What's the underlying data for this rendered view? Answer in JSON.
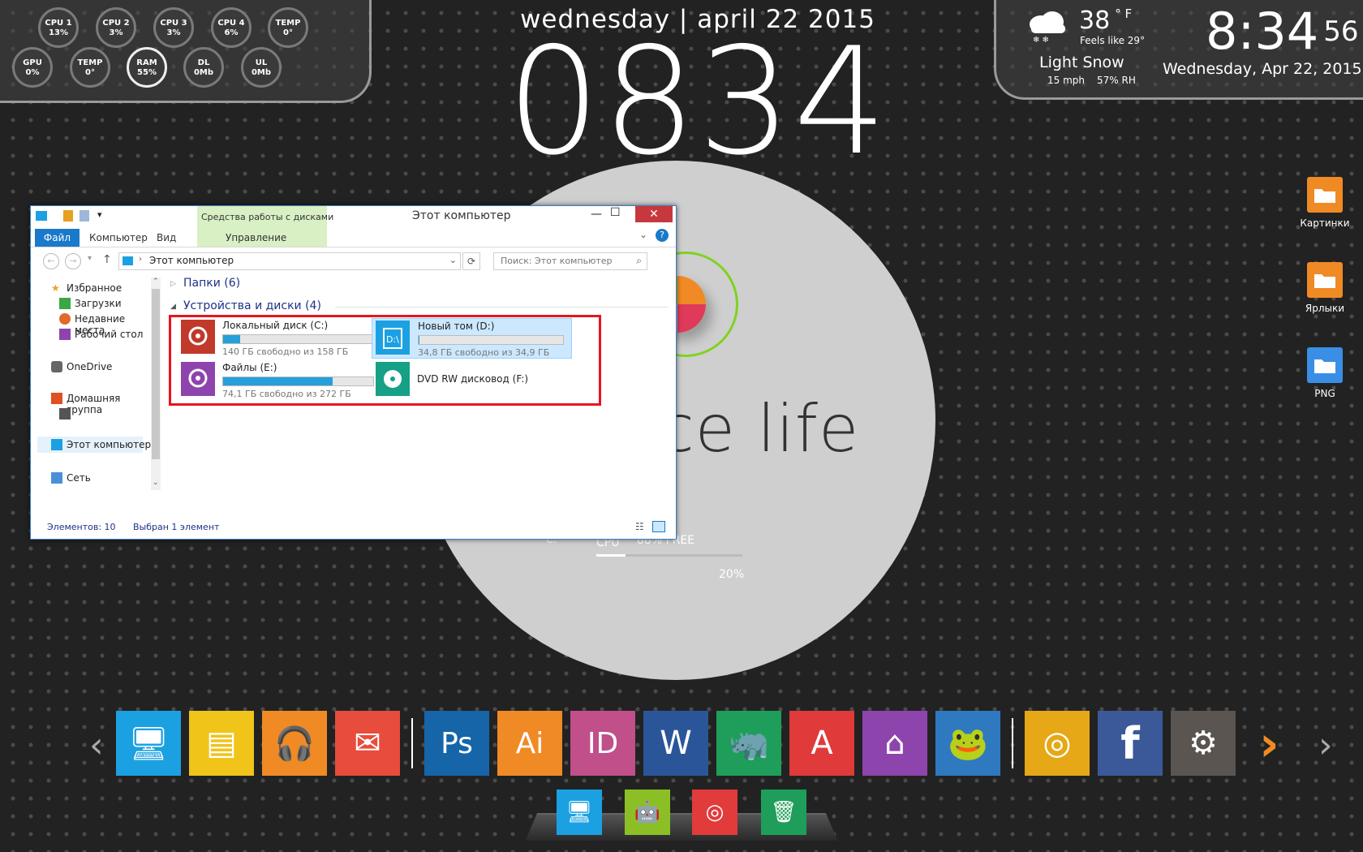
{
  "sysmon": {
    "row1": [
      {
        "label": "CPU 1",
        "value": "13%"
      },
      {
        "label": "CPU 2",
        "value": "3%"
      },
      {
        "label": "CPU 3",
        "value": "3%"
      },
      {
        "label": "CPU 4",
        "value": "6%"
      },
      {
        "label": "TEMP",
        "value": "0°"
      }
    ],
    "row2": [
      {
        "label": "GPU",
        "value": "0%"
      },
      {
        "label": "TEMP",
        "value": "0°"
      },
      {
        "label": "RAM",
        "value": "55%"
      },
      {
        "label": "DL",
        "value": "0Mb"
      },
      {
        "label": "UL",
        "value": "0Mb"
      }
    ]
  },
  "clock": {
    "date_line": "wednesday | april 22 2015",
    "big_time": "0834"
  },
  "weather": {
    "temp": "38",
    "unit": "° F",
    "feels": "Feels like 29°",
    "condition": "Light Snow",
    "wind": "15 mph",
    "humidity": "57% RH"
  },
  "rclock": {
    "hm": "8:34",
    "sec": "56",
    "date": "Wednesday, Apr 22, 2015"
  },
  "disc": {
    "text": "nce life",
    "cpu_label": "CPU",
    "free": "88% FREE",
    "c_label": "C:",
    "pct": "20%"
  },
  "explorer": {
    "title": "Этот компьютер",
    "disk_tools": "Средства работы с дисками",
    "tabs": {
      "file": "Файл",
      "computer": "Компьютер",
      "view": "Вид",
      "manage": "Управление"
    },
    "address": "Этот компьютер",
    "search_placeholder": "Поиск: Этот компьютер",
    "nav": {
      "favorites": "Избранное",
      "downloads": "Загрузки",
      "recent": "Недавние места",
      "desktop": "Рабочий стол",
      "onedrive": "OneDrive",
      "homegroup": "Домашняя группа",
      "thispc": "Этот компьютер",
      "network": "Сеть"
    },
    "folders_header": "Папки (6)",
    "devices_header": "Устройства и диски (4)",
    "drives": [
      {
        "name": "Локальный диск (C:)",
        "free": "140 ГБ свободно из 158 ГБ",
        "used": 0.114
      },
      {
        "name": "Новый том (D:)",
        "free": "34,8 ГБ свободно из 34,9 ГБ",
        "used": 0.003
      },
      {
        "name": "Файлы (E:)",
        "free": "74,1 ГБ свободно из 272 ГБ",
        "used": 0.728
      },
      {
        "name": "DVD RW дисковод (F:)"
      }
    ],
    "status": {
      "items": "Элементов: 10",
      "selected": "Выбран 1 элемент"
    },
    "d_glyph": "D:\\"
  },
  "desktop_icons": [
    "Картинки",
    "Ярлыки",
    "PNG"
  ],
  "dock": [
    {
      "name": "computer",
      "color": "#1ba1e2",
      "glyph": "🖥"
    },
    {
      "name": "notes",
      "color": "#f0c419",
      "glyph": "▤"
    },
    {
      "name": "music",
      "color": "#f08a24",
      "glyph": "🎧"
    },
    {
      "name": "mail",
      "color": "#e74c3c",
      "glyph": "✉"
    },
    {
      "name": "photoshop",
      "color": "#1565a8",
      "glyph": "Ps"
    },
    {
      "name": "illustrator",
      "color": "#f08a24",
      "glyph": "Ai"
    },
    {
      "name": "indesign",
      "color": "#c04f8a",
      "glyph": "ID"
    },
    {
      "name": "word",
      "color": "#2a5699",
      "glyph": "W"
    },
    {
      "name": "rhino",
      "color": "#1e9e5a",
      "glyph": "🦏"
    },
    {
      "name": "acrobat",
      "color": "#e03a3a",
      "glyph": "A"
    },
    {
      "name": "home-design",
      "color": "#8e44ad",
      "glyph": "⌂"
    },
    {
      "name": "frog",
      "color": "#2f79c0",
      "glyph": "🐸"
    },
    {
      "name": "chrome",
      "color": "#e6a817",
      "glyph": "◎"
    },
    {
      "name": "facebook",
      "color": "#3b5998",
      "glyph": "f"
    },
    {
      "name": "steam",
      "color": "#5a5550",
      "glyph": "⚙"
    }
  ],
  "mini_dock": [
    {
      "name": "computer",
      "color": "#1ba1e2",
      "glyph": "🖥"
    },
    {
      "name": "android",
      "color": "#8cbf26",
      "glyph": "🤖"
    },
    {
      "name": "chrome",
      "color": "#e23b3b",
      "glyph": "◎"
    },
    {
      "name": "trash",
      "color": "#1e9e5a",
      "glyph": "🗑"
    }
  ]
}
